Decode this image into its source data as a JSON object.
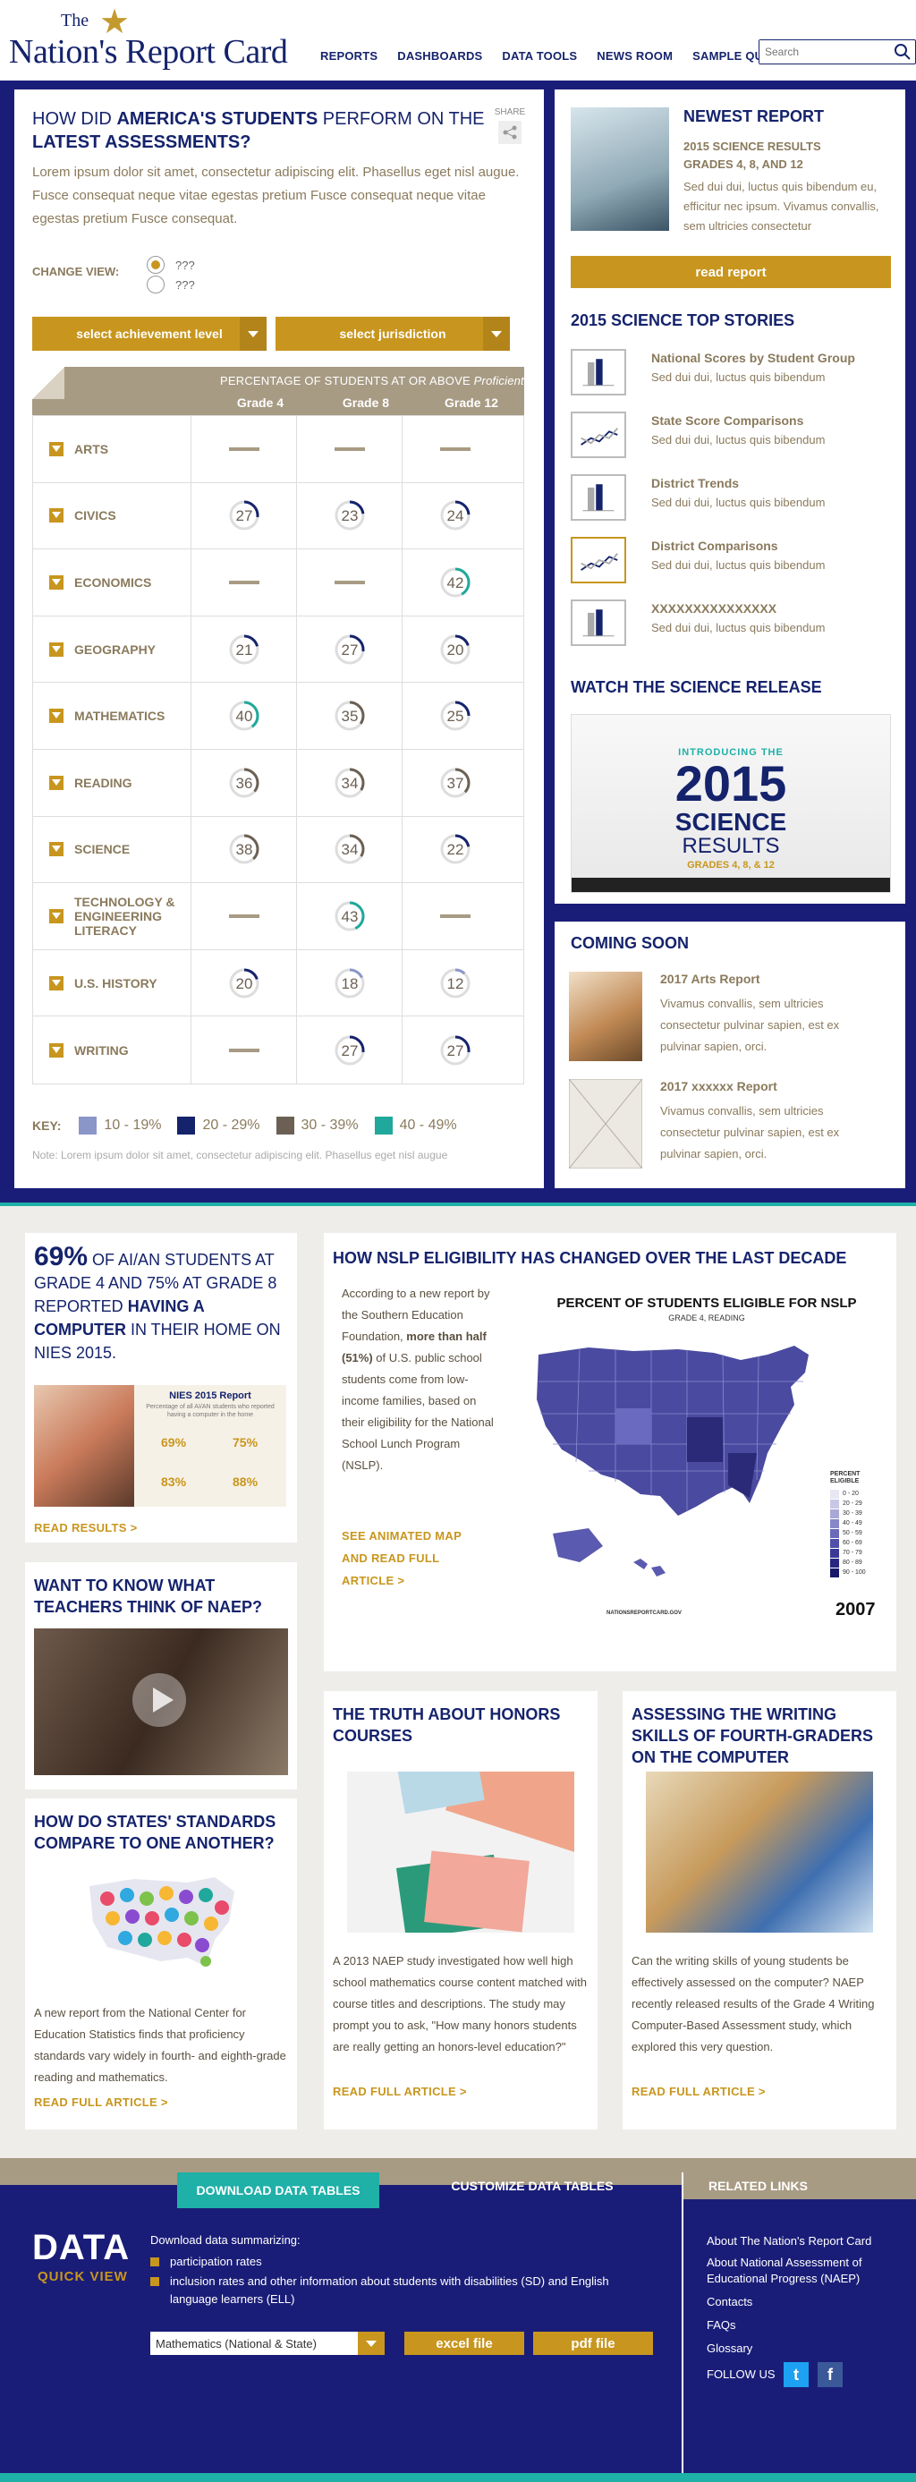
{
  "header": {
    "logo_the": "The",
    "logo_main": "Nation's Report Card",
    "nav": [
      "REPORTS",
      "DASHBOARDS",
      "DATA TOOLS",
      "NEWS ROOM",
      "SAMPLE QUESTIONS"
    ],
    "search_placeholder": "Search"
  },
  "assessments": {
    "title_pre": "HOW DID ",
    "title_bold1": "AMERICA'S STUDENTS",
    "title_mid": " PERFORM ON THE ",
    "title_bold2": "LATEST ASSESSMENTS?",
    "share": "SHARE",
    "description": "Lorem ipsum dolor sit amet, consectetur adipiscing elit. Phasellus eget nisl augue. Fusce consequat neque vitae egestas pretium Fusce consequat neque vitae egestas pretium Fusce consequat.",
    "change_view_label": "CHANGE VIEW:",
    "view_options": [
      {
        "label": "???",
        "selected": true
      },
      {
        "label": "???",
        "selected": false
      }
    ],
    "select_achievement": "select achievement level",
    "select_jurisdiction": "select jurisdiction",
    "table_caption_pre": "PERCENTAGE OF STUDENTS AT OR ABOVE ",
    "table_caption_level": "Proficient",
    "grades": [
      "Grade 4",
      "Grade 8",
      "Grade 12"
    ],
    "rows": [
      {
        "subject": "ARTS",
        "values": [
          null,
          null,
          null
        ]
      },
      {
        "subject": "CIVICS",
        "values": [
          27,
          23,
          24
        ]
      },
      {
        "subject": "ECONOMICS",
        "values": [
          null,
          null,
          42
        ]
      },
      {
        "subject": "GEOGRAPHY",
        "values": [
          21,
          27,
          20
        ]
      },
      {
        "subject": "MATHEMATICS",
        "values": [
          40,
          35,
          25
        ]
      },
      {
        "subject": "READING",
        "values": [
          36,
          34,
          37
        ]
      },
      {
        "subject": "SCIENCE",
        "values": [
          38,
          34,
          22
        ]
      },
      {
        "subject": "TECHNOLOGY & ENGINEERING LITERACY",
        "values": [
          null,
          43,
          null
        ]
      },
      {
        "subject": "U.S. HISTORY",
        "values": [
          20,
          18,
          12
        ]
      },
      {
        "subject": "WRITING",
        "values": [
          null,
          27,
          27
        ]
      }
    ],
    "key_label": "KEY:",
    "key": [
      {
        "label": "10 - 19%",
        "color": "#8b96c8"
      },
      {
        "label": "20 - 29%",
        "color": "#15236c"
      },
      {
        "label": "30 - 39%",
        "color": "#6b6053"
      },
      {
        "label": "40 - 49%",
        "color": "#1fa89b"
      }
    ],
    "note": "Note: Lorem ipsum dolor sit amet, consectetur adipiscing elit. Phasellus eget nisl augue"
  },
  "newest_report": {
    "title": "NEWEST REPORT",
    "subtitle_line1": "2015 SCIENCE RESULTS",
    "subtitle_line2": "GRADES 4, 8, AND 12",
    "text": "Sed dui dui, luctus quis bibendum eu, efficitur nec ipsum. Vivamus convallis, sem ultricies consectetur",
    "button": "read report"
  },
  "top_stories": {
    "title": "2015 SCIENCE TOP STORIES",
    "items": [
      {
        "title": "National Scores by Student Group",
        "desc": "Sed dui dui, luctus quis bibendum",
        "icon": "bar-chart-icon"
      },
      {
        "title": "State Score Comparisons",
        "desc": "Sed dui dui, luctus quis bibendum",
        "icon": "line-chart-icon"
      },
      {
        "title": "District Trends",
        "desc": "Sed dui dui, luctus quis bibendum",
        "icon": "bar-chart-icon"
      },
      {
        "title": "District Comparisons",
        "desc": "Sed dui dui, luctus quis bibendum",
        "icon": "line-chart-icon"
      },
      {
        "title": "XXXXXXXXXXXXXXX",
        "desc": "Sed dui dui, luctus quis bibendum",
        "icon": "bar-chart-icon"
      }
    ]
  },
  "science_release": {
    "title": "WATCH THE SCIENCE RELEASE",
    "video_line1": "INTRODUCING THE",
    "video_line2": "2015",
    "video_line3": "SCIENCE",
    "video_line4": "RESULTS",
    "video_line5": "GRADES 4, 8, & 12"
  },
  "coming_soon": {
    "title": "COMING SOON",
    "items": [
      {
        "title": "2017 Arts Report",
        "desc": "Vivamus convallis, sem ultricies consectetur pulvinar sapien, est ex pulvinar sapien, orci."
      },
      {
        "title": "2017 xxxxxx Report",
        "desc": "Vivamus convallis, sem ultricies consectetur pulvinar sapien, est ex pulvinar sapien, orci."
      }
    ]
  },
  "nies": {
    "big": "69%",
    "text_a": " OF AI/AN STUDENTS AT GRADE 4 AND 75% AT GRADE 8 REPORTED ",
    "text_bold": "HAVING A COMPUTER",
    "text_b": " IN THEIR HOME ON NIES 2015.",
    "infographic_title": "NIES 2015 Report",
    "infographic_sub": "Percentage of all AI/AN students who reported having a computer in the home",
    "stat1": "69%",
    "stat2": "75%",
    "stat3": "83%",
    "stat4": "88%",
    "link": "READ RESULTS >"
  },
  "nslp": {
    "title": "HOW NSLP ELIGIBILITY HAS CHANGED OVER THE LAST DECADE",
    "text_a": "According to a new report by the Southern Education Foundation, ",
    "text_bold": "more than half (51%)",
    "text_b": " of U.S. public school students come from low-income families, based on their eligibility for the National School Lunch Program (NSLP).",
    "link": "SEE ANIMATED MAP AND READ FULL ARTICLE >",
    "map_title": "PERCENT OF STUDENTS ELIGIBLE FOR NSLP",
    "map_sub": "GRADE 4, READING",
    "legend_title": "PERCENT ELIGIBLE",
    "legend": [
      "0 - 20",
      "20 - 29",
      "30 - 39",
      "40 - 49",
      "50 - 59",
      "60 - 69",
      "70 - 79",
      "80 - 89",
      "90 - 100"
    ],
    "source": "NATIONSREPORTCARD.GOV",
    "year": "2007"
  },
  "teachers": {
    "title": "WANT TO KNOW WHAT TEACHERS THINK OF NAEP?"
  },
  "states": {
    "title": "HOW DO STATES' STANDARDS COMPARE TO ONE ANOTHER?",
    "text": "A new report from the National Center for Education Statistics finds that proficiency standards vary widely in fourth- and eighth-grade reading and mathematics.",
    "link": "READ FULL ARTICLE >"
  },
  "honors": {
    "title": "THE TRUTH ABOUT HONORS COURSES",
    "text": "A 2013 NAEP study investigated how well high school mathematics course content matched with course titles and descriptions. The study may prompt you to ask, \"How many honors students are really getting an honors-level education?\"",
    "link": "READ FULL ARTICLE >"
  },
  "writing": {
    "title": "ASSESSING THE WRITING SKILLS OF FOURTH-GRADERS ON THE COMPUTER",
    "text": "Can the writing skills of young students be effectively assessed on the computer? NAEP recently released results of the Grade 4 Writing Computer-Based Assessment study, which explored this very question.",
    "link": "READ FULL ARTICLE >"
  },
  "footer": {
    "tab_download": "DOWNLOAD DATA TABLES",
    "tab_customize": "CUSTOMIZE DATA TABLES",
    "related_title": "RELATED LINKS",
    "data_logo": "DATA",
    "quick_view": "QUICK VIEW",
    "intro": "Download data summarizing:",
    "bullets": [
      "participation rates",
      "inclusion rates and other information about students with disabilities (SD) and English language learners (ELL)"
    ],
    "select_value": "Mathematics (National & State)",
    "excel": "excel file",
    "pdf": "pdf file",
    "links": [
      "About The Nation's Report Card",
      "About National Assessment of Educational Progress (NAEP)",
      "Contacts",
      "FAQs",
      "Glossary"
    ],
    "follow": "FOLLOW US"
  }
}
